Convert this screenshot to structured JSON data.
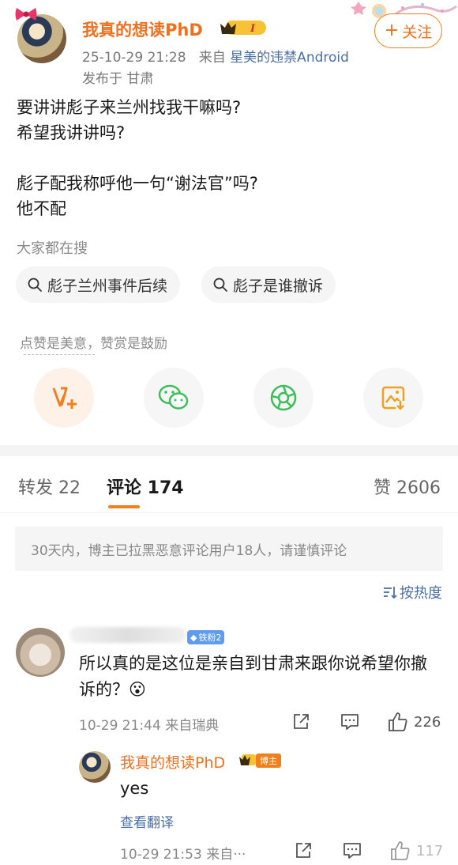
{
  "post": {
    "author": "我真的想读PhD",
    "vip_level": "I",
    "timestamp": "25-10-29 21:28",
    "source_prefix": "来自",
    "source": "星美的违禁Android",
    "location": "发布于 甘肃",
    "follow_label": "关注",
    "body_lines": [
      "要讲讲彪子来兰州找我干嘛吗?",
      "希望我讲讲吗?",
      "",
      "彪子配我称呼他一句“谢法官”吗?",
      "他不配"
    ]
  },
  "search": {
    "title": "大家都在搜",
    "chips": [
      "彪子兰州事件后续",
      "彪子是谁撤诉"
    ]
  },
  "reward": {
    "label": "点赞是美意，赞赏是鼓励"
  },
  "share_icons": [
    "reward-icon",
    "wechat-icon",
    "moments-icon",
    "save-image-icon"
  ],
  "tabs": {
    "repost": "转发 22",
    "comment": "评论 174",
    "like": "赞 2606"
  },
  "notice": "30天内，博主已拉黑恶意评论用户18人，请谨慎评论",
  "sort_label": "按热度",
  "comment": {
    "fan_badge": "铁粉2",
    "text": "所以真的是这位是亲自到甘肃来跟你说希望你撤诉的？😮",
    "meta": "10-29 21:44  来自瑞典",
    "like_count": "226"
  },
  "reply": {
    "author": "我真的想读PhD",
    "host_badge": "博主",
    "text": "yes",
    "translate": "查看翻译",
    "meta": "10-29 21:53  来自···",
    "like_count": "117"
  },
  "colors": {
    "accent": "#f0701d",
    "link": "#4a6fa5",
    "wechat_green": "#3cbf5a",
    "save_orange": "#f0a020"
  }
}
